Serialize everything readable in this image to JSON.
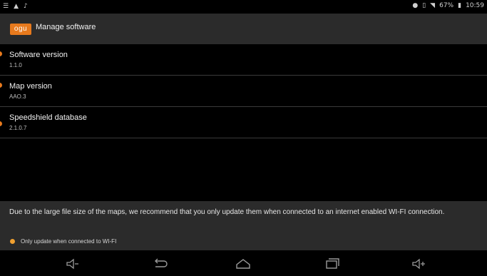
{
  "status_bar": {
    "battery": "67%",
    "time": "10:59"
  },
  "action_bar": {
    "logo_text": "ogu",
    "title": "Manage software"
  },
  "items": [
    {
      "title": "Software version",
      "value": "1.1.0"
    },
    {
      "title": "Map version",
      "value": "AAO.3"
    },
    {
      "title": "Speedshield database",
      "value": "2.1.0.7"
    }
  ],
  "footer": {
    "notice": "Due to the large file size of the maps, we recommend that you only update them when connected to an internet enabled WI-FI connection.",
    "checkbox_label": "Only update when connected to WI-FI",
    "checkbox_checked": true
  },
  "colors": {
    "accent": "#e87a1d",
    "background": "#000000",
    "panel": "#2b2b2b"
  },
  "icons": [
    "volume-down-icon",
    "back-icon",
    "home-icon",
    "recents-icon",
    "volume-up-icon"
  ]
}
